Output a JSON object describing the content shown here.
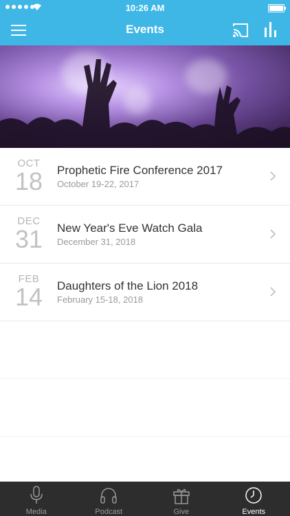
{
  "status_bar": {
    "time": "10:26 AM"
  },
  "nav": {
    "title": "Events"
  },
  "events": [
    {
      "month": "OCT",
      "day": "18",
      "name": "Prophetic Fire Conference 2017",
      "date": "October 19-22, 2017"
    },
    {
      "month": "DEC",
      "day": "31",
      "name": "New Year's Eve Watch Gala",
      "date": "December 31, 2018"
    },
    {
      "month": "FEB",
      "day": "14",
      "name": "Daughters of the Lion 2018",
      "date": "February 15-18, 2018"
    }
  ],
  "tabs": [
    {
      "label": "Media",
      "icon": "microphone-icon",
      "active": false
    },
    {
      "label": "Podcast",
      "icon": "headphones-icon",
      "active": false
    },
    {
      "label": "Give",
      "icon": "gift-icon",
      "active": false
    },
    {
      "label": "Events",
      "icon": "clock-icon",
      "active": true
    }
  ],
  "colors": {
    "accent": "#3fb7e6",
    "tab_bar": "#2d2d2d"
  }
}
